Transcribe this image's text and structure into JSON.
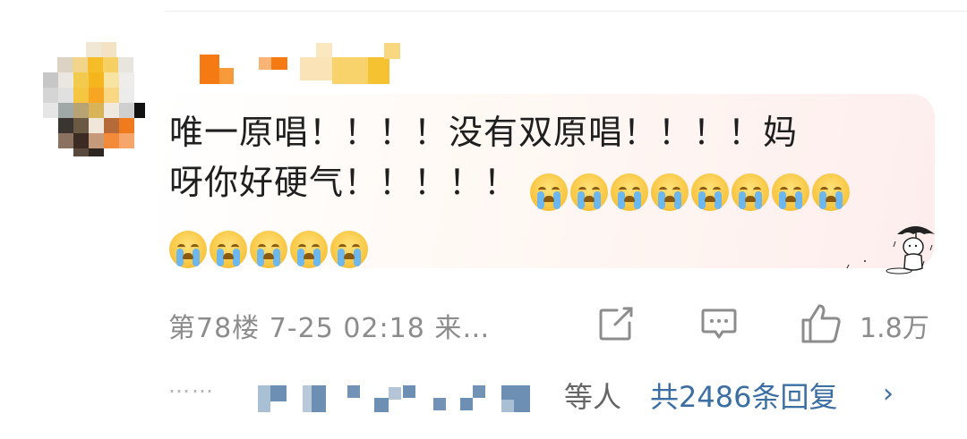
{
  "comment": {
    "username": "",
    "line1": "唯一原唱！！！！没有双原唱！！！！妈",
    "line2": "呀你好硬气！！！！！",
    "emojis": [
      "crying-emoji",
      "crying-emoji",
      "crying-emoji",
      "crying-emoji",
      "crying-emoji",
      "crying-emoji",
      "crying-emoji",
      "crying-emoji",
      "crying-emoji",
      "crying-emoji",
      "crying-emoji",
      "crying-emoji",
      "crying-emoji"
    ],
    "sticker": "person-under-umbrella-sticker"
  },
  "meta": {
    "text": "第78楼  7-25 02:18  来…"
  },
  "actions": {
    "share_icon": "share-icon",
    "comment_icon": "comment-icon",
    "like_icon": "thumbs-up-icon",
    "likes": "1.8万"
  },
  "replies": {
    "dots": "……",
    "suffix": "等人",
    "count_label": "共2486条回复",
    "chevron": "›"
  },
  "colors": {
    "link": "#3b6fa3",
    "meta": "#8c8c8c",
    "bubble_tint": "#fdeeed",
    "username_orange": "#f57a14",
    "username_yellow": "#f5c84a"
  }
}
